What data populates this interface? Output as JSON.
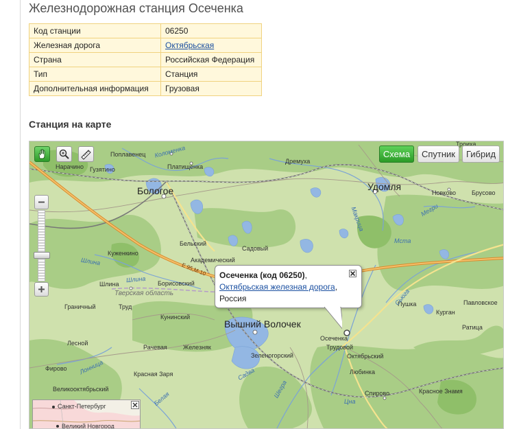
{
  "page": {
    "title": "Железнодорожная станция Осеченка",
    "map_heading": "Станция на карте"
  },
  "info_table": [
    {
      "key": "Код станции",
      "value": "06250",
      "link": false
    },
    {
      "key": "Железная дорога",
      "value": "Октябрьская",
      "link": true
    },
    {
      "key": "Страна",
      "value": "Российская Федерация",
      "link": false
    },
    {
      "key": "Тип",
      "value": "Станция",
      "link": false
    },
    {
      "key": "Дополнительная информация",
      "value": "Грузовая",
      "link": false
    }
  ],
  "map": {
    "tools": {
      "pan": "hand-icon",
      "zoom": "magnifier-icon",
      "ruler": "ruler-icon",
      "active": "pan"
    },
    "type_buttons": [
      {
        "label": "Схема",
        "active": true
      },
      {
        "label": "Спутник",
        "active": false
      },
      {
        "label": "Гибрид",
        "active": false
      }
    ],
    "zoom_level": 9,
    "popup": {
      "title": "Осеченка (код 06250)",
      "title_suffix": ",",
      "railway_link": "Октябрьская железная дорога",
      "railway_suffix": ",",
      "country": "Россия"
    },
    "labels": {
      "cities": [
        "Бологое",
        "Удомля",
        "Вышний Волочек"
      ],
      "settlements": [
        "Поплавенец",
        "Нарачино",
        "Гузятино",
        "Платищенка",
        "Дремуха",
        "Троиха",
        "Новково",
        "Брусово",
        "Бельский",
        "Садовый",
        "Академический",
        "Куженкино",
        "Шлина",
        "Борисовский",
        "Граничный",
        "Труд",
        "Кунинский",
        "Железняк",
        "Лесной",
        "Рачевая",
        "Фирово",
        "Красная Заря",
        "Великооктябрьский",
        "Зеленогорский",
        "Осеченка",
        "Трудовой",
        "Октябрьский",
        "Любинка",
        "Спирово",
        "Красное Знамя",
        "Пушка",
        "Павловское",
        "Курган",
        "Ратица"
      ],
      "rivers": [
        "Коломенка",
        "Шлина",
        "Шлина",
        "Лонница",
        "Мста",
        "Цна",
        "Сьюга",
        "Шегра",
        "Садва",
        "Белая",
        "Макрица",
        "Мегри"
      ],
      "region": "Тверская область",
      "road": "Е 95,М-10"
    },
    "minimap": {
      "labels": [
        "Санкт-Петербург",
        "Великий Новгород"
      ],
      "close_icon": "close-icon"
    }
  },
  "colors": {
    "table_bg": "#fff8dc",
    "table_border": "#f0d27e",
    "link": "#1a4fa0",
    "active_green": "#2e9b2a",
    "map_field": "#cfe1ad",
    "map_forest": "#a9cd86",
    "water": "#93b7e3"
  }
}
